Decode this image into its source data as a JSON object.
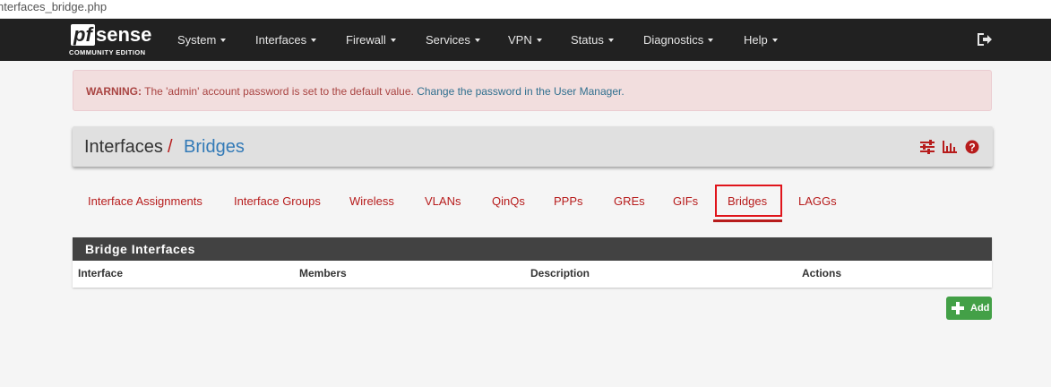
{
  "browser": {
    "url_fragment": "nterfaces_bridge.php"
  },
  "navbar": {
    "logo_pf": "pf",
    "logo_sense": "sense",
    "logo_sub": "COMMUNITY EDITION",
    "menu": [
      "System",
      "Interfaces",
      "Firewall",
      "Services",
      "VPN",
      "Status",
      "Diagnostics",
      "Help"
    ],
    "logout_icon": "sign-out-icon"
  },
  "warning": {
    "label": "WARNING:",
    "message": " The 'admin' account password is set to the default value. ",
    "link": "Change the password in the User Manager."
  },
  "breadcrumb": {
    "parent": "Interfaces",
    "separator": "/",
    "current": "Bridges",
    "icons": [
      "sliders-icon",
      "bar-chart-icon",
      "help-icon"
    ]
  },
  "tabs": {
    "items": [
      "Interface Assignments",
      "Interface Groups",
      "Wireless",
      "VLANs",
      "QinQs",
      "PPPs",
      "GREs",
      "GIFs",
      "Bridges",
      "LAGGs"
    ],
    "active": "Bridges"
  },
  "panel": {
    "title": "Bridge Interfaces",
    "columns": [
      "Interface",
      "Members",
      "Description",
      "Actions"
    ],
    "rows": []
  },
  "actions": {
    "add_label": "Add",
    "add_icon": "plus-icon"
  },
  "colors": {
    "navbar": "#212121",
    "accent_red": "#b71c1c",
    "link_blue": "#337ab7",
    "success_green": "#43a047",
    "warning_bg": "#f2dede"
  }
}
